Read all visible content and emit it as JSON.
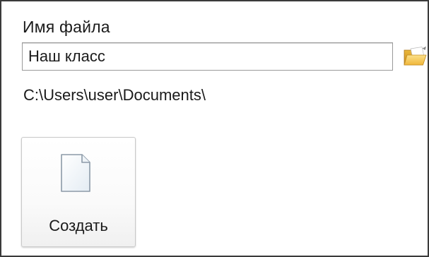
{
  "form": {
    "filename_label": "Имя файла",
    "filename_value": "Наш класс",
    "browse_icon": "folder-open-icon",
    "path": "C:\\Users\\user\\Documents\\"
  },
  "create": {
    "label": "Создать",
    "icon": "new-document-icon"
  },
  "colors": {
    "frame_border": "#3a3a3a",
    "input_border": "#9a9a9a",
    "folder_yellow": "#f2c14a",
    "folder_accent": "#d89a22",
    "text": "#1a1a1a"
  }
}
